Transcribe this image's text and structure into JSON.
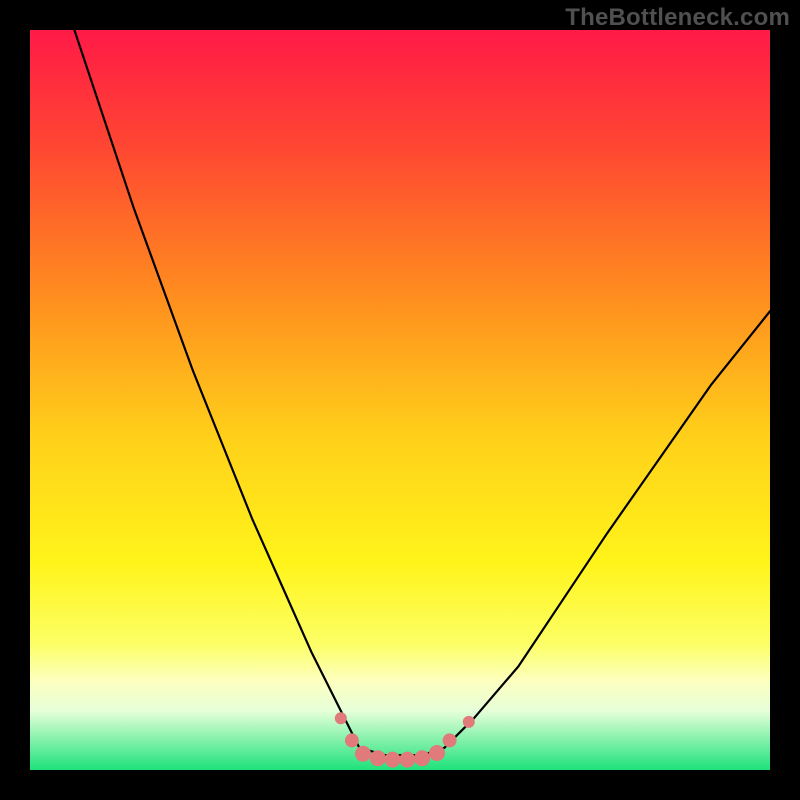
{
  "watermark": "TheBottleneck.com",
  "chart_data": {
    "type": "line",
    "title": "",
    "xlabel": "",
    "ylabel": "",
    "xlim": [
      0,
      100
    ],
    "ylim": [
      0,
      100
    ],
    "grid": false,
    "legend": false,
    "gradient_stops": [
      {
        "pct": 0,
        "color": "#ff1a47"
      },
      {
        "pct": 15,
        "color": "#ff4433"
      },
      {
        "pct": 35,
        "color": "#ff8a1f"
      },
      {
        "pct": 55,
        "color": "#ffd01a"
      },
      {
        "pct": 72,
        "color": "#fff41a"
      },
      {
        "pct": 83,
        "color": "#fcff66"
      },
      {
        "pct": 88,
        "color": "#fdffbf"
      },
      {
        "pct": 92,
        "color": "#e6ffd9"
      },
      {
        "pct": 100,
        "color": "#1de27a"
      }
    ],
    "series": [
      {
        "name": "bottleneck-curve",
        "stroke": "#000000",
        "stroke_width": 2.2,
        "x": [
          6,
          10,
          14,
          18,
          22,
          26,
          30,
          34,
          38,
          42,
          44.5,
          48,
          53,
          56,
          60,
          66,
          72,
          78,
          85,
          92,
          100
        ],
        "values": [
          100,
          88,
          76,
          65,
          54,
          44,
          34,
          25,
          16,
          8,
          3,
          2,
          2,
          3,
          7,
          14,
          23,
          32,
          42,
          52,
          62
        ]
      }
    ],
    "markers": {
      "name": "optimal-markers",
      "color": "#e17a7a",
      "points": [
        {
          "x": 42.0,
          "y": 7.0,
          "r": 6
        },
        {
          "x": 43.5,
          "y": 4.0,
          "r": 7
        },
        {
          "x": 45.0,
          "y": 2.2,
          "r": 8
        },
        {
          "x": 47.0,
          "y": 1.6,
          "r": 8
        },
        {
          "x": 49.0,
          "y": 1.4,
          "r": 8
        },
        {
          "x": 51.0,
          "y": 1.4,
          "r": 8
        },
        {
          "x": 53.0,
          "y": 1.6,
          "r": 8
        },
        {
          "x": 55.0,
          "y": 2.3,
          "r": 8
        },
        {
          "x": 56.7,
          "y": 4.0,
          "r": 7
        },
        {
          "x": 59.3,
          "y": 6.5,
          "r": 6
        }
      ]
    }
  }
}
